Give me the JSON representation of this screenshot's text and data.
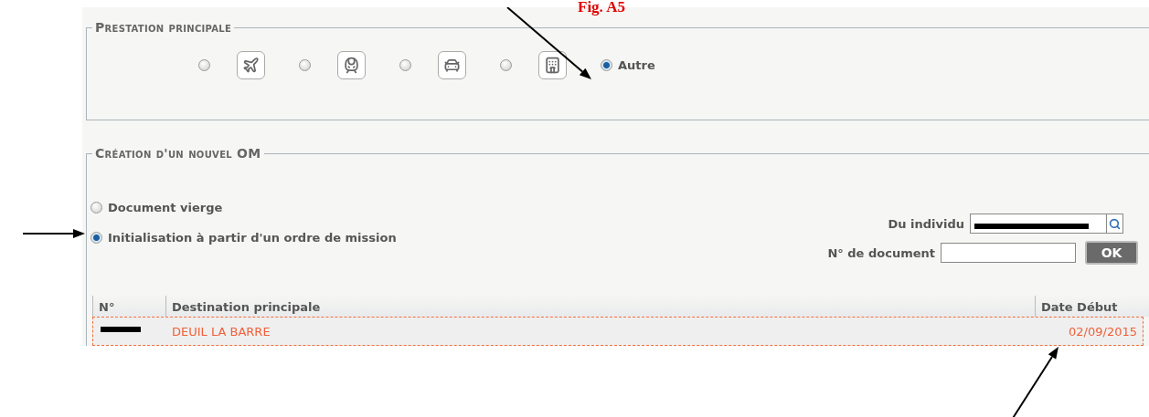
{
  "caption": "Fig. A5",
  "prestation": {
    "title": "Prestation principale",
    "options": [
      {
        "kind": "plane",
        "selected": false
      },
      {
        "kind": "train",
        "selected": false
      },
      {
        "kind": "car",
        "selected": false
      },
      {
        "kind": "hotel",
        "selected": false
      },
      {
        "kind": "text",
        "label": "Autre",
        "selected": true
      }
    ]
  },
  "creation": {
    "title": "Création d'un nouvel OM",
    "modes": [
      {
        "label": "Document vierge",
        "selected": false
      },
      {
        "label": "Initialisation à partir d'un ordre de mission",
        "selected": true
      }
    ],
    "individu": {
      "label": "Du individu"
    },
    "document": {
      "label": "N° de document"
    },
    "ok": "OK",
    "table": {
      "columns": [
        "N°",
        "Destination principale",
        "Date Début"
      ],
      "rows": [
        {
          "destination": "DEUIL LA BARRE",
          "date": "02/09/2015",
          "selected": true
        }
      ]
    }
  }
}
